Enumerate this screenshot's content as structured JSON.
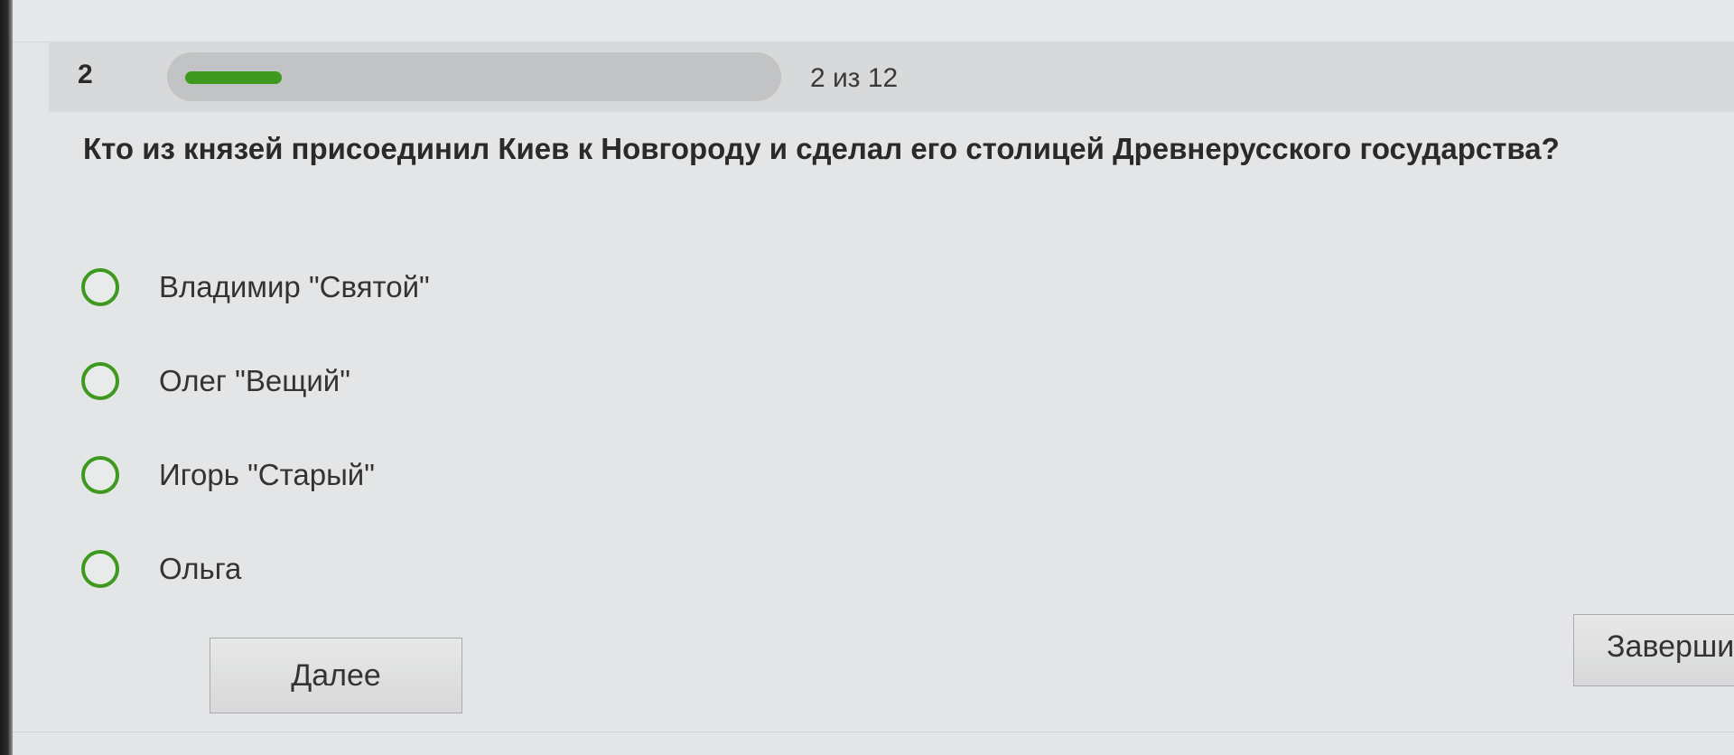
{
  "question": {
    "number": "2",
    "progress_text": "2 из 12",
    "progress_fraction": 0.1667,
    "text": "Кто из князей присоединил Киев к Новгороду и сделал его столицей Древнерусского государства?"
  },
  "options": [
    {
      "label": "Владимир \"Святой\"",
      "selected": false
    },
    {
      "label": "Олег \"Вещий\"",
      "selected": false
    },
    {
      "label": "Игорь \"Старый\"",
      "selected": false
    },
    {
      "label": "Ольга",
      "selected": false
    }
  ],
  "buttons": {
    "next_label": "Далее",
    "finish_label": "Заверши"
  },
  "colors": {
    "accent": "#3d9a1e",
    "background": "#e4e5e6",
    "header": "#d8d9da"
  }
}
